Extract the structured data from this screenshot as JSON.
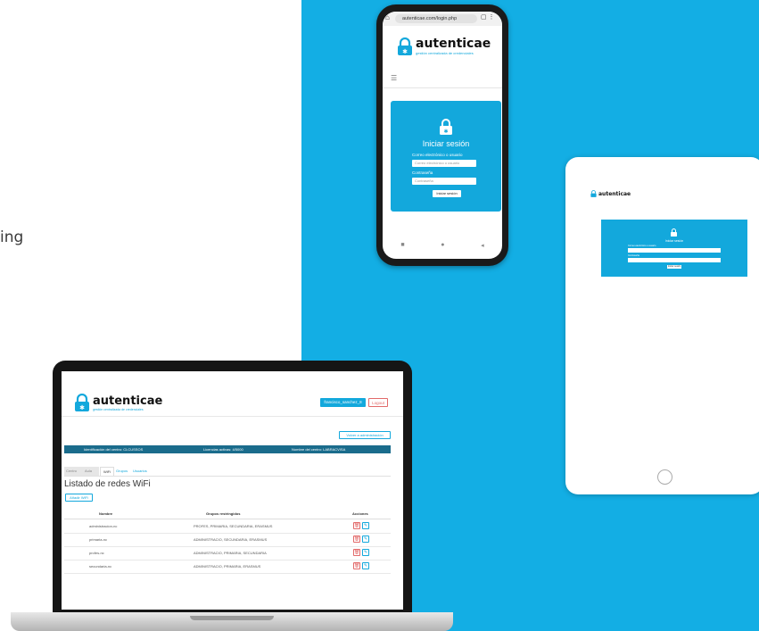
{
  "partial_text": "ing",
  "brand": {
    "name": "autenticae",
    "tagline": "gestión centralizada de credenciales",
    "color": "#13a8dc"
  },
  "phone": {
    "url": "autenticae.com/login.php",
    "title": "Iniciar sesión",
    "user_label": "Correo electrónico o usuario",
    "user_placeholder": "Correo electrónico o usuario",
    "pass_label": "Contraseña",
    "pass_placeholder": "Contraseña",
    "submit": "Iniciar sesión",
    "nav": [
      "■",
      "●",
      "◂"
    ]
  },
  "tablet": {
    "title": "Iniciar sesión",
    "user_label": "Correo electrónico o usuario",
    "pass_label": "Contraseña",
    "submit": "Iniciar sesión"
  },
  "laptop": {
    "user": "francisco_sanchez_8",
    "logout": "Logout",
    "back": "Volver a administración",
    "info": {
      "center_id": "Identificación del centro: CLCUSSOS",
      "licenses": "Licencias activas: 4/5000",
      "center_name": "Nombre del centro: LABRACVISA"
    },
    "tabs": [
      "Centro",
      "Aula",
      "WiFi",
      "Grupos",
      "Usuarios"
    ],
    "active_tab": "WiFi",
    "page_title": "Listado de redes WiFi",
    "add_button": "Añadir WiFi",
    "columns": [
      "Nombre",
      "Grupos restringidos",
      "Acciones"
    ],
    "rows": [
      {
        "name": "administracion-nc",
        "groups": "PROFES, PRIMARIA, SECUNDARIA, ERASMUS"
      },
      {
        "name": "primaria-nc",
        "groups": "ADMINISTRACIO, SECUNDARIA, ERASMUS"
      },
      {
        "name": "profes-nc",
        "groups": "ADMINISTRACIO, PRIMARIA, SECUNDARIA"
      },
      {
        "name": "secundaria-nc",
        "groups": "ADMINISTRACIO, PRIMARIA, ERASMUS"
      }
    ]
  }
}
